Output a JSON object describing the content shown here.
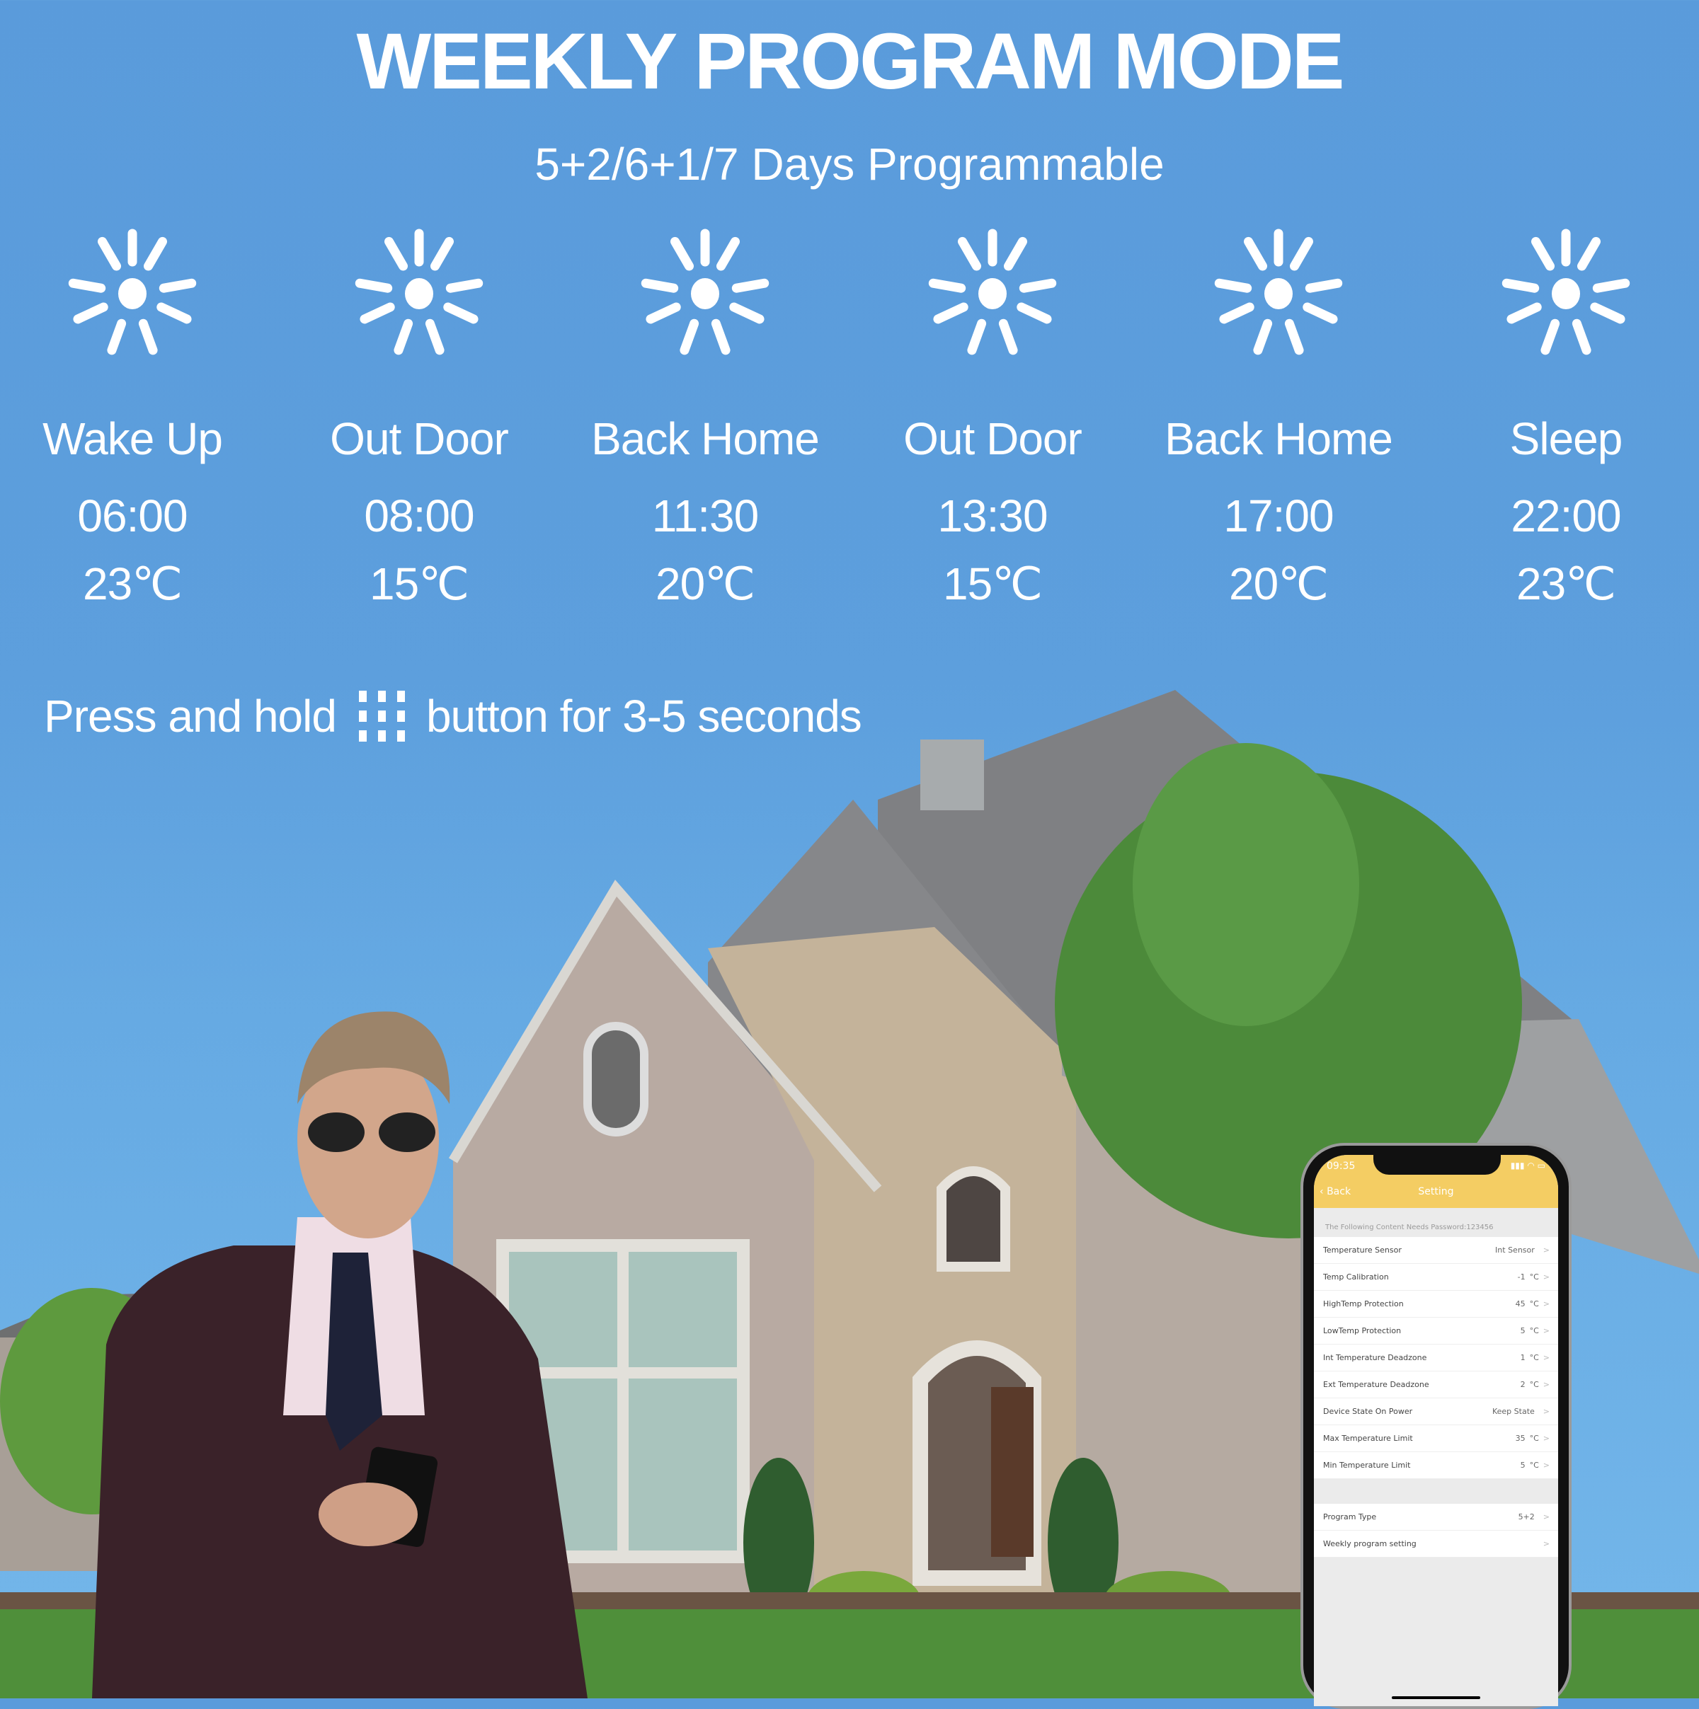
{
  "header": {
    "title": "WEEKLY PROGRAM MODE",
    "subtitle": "5+2/6+1/7 Days Programmable"
  },
  "schedule": [
    {
      "icon": "sun-icon",
      "label": "Wake Up",
      "time": "06:00",
      "temp": "23℃"
    },
    {
      "icon": "sun-icon",
      "label": "Out Door",
      "time": "08:00",
      "temp": "15℃"
    },
    {
      "icon": "sun-icon",
      "label": "Back Home",
      "time": "11:30",
      "temp": "20℃"
    },
    {
      "icon": "sun-icon",
      "label": "Out Door",
      "time": "13:30",
      "temp": "15℃"
    },
    {
      "icon": "sun-icon",
      "label": "Back Home",
      "time": "17:00",
      "temp": "20℃"
    },
    {
      "icon": "sun-icon",
      "label": "Sleep",
      "time": "22:00",
      "temp": "23℃"
    }
  ],
  "hint": {
    "before": "Press and hold",
    "icon": "grid-button-icon",
    "after": "button for 3-5 seconds"
  },
  "phone": {
    "status_time": "09:35",
    "status_icons": "signal wifi battery",
    "back_label": "Back",
    "screen_title": "Setting",
    "section_note": "The Following Content Needs Password:123456",
    "settings": [
      {
        "label": "Temperature Sensor",
        "value": "Int Sensor",
        "unit": ""
      },
      {
        "label": "Temp Calibration",
        "value": "-1",
        "unit": "°C"
      },
      {
        "label": "HighTemp Protection",
        "value": "45",
        "unit": "°C"
      },
      {
        "label": "LowTemp Protection",
        "value": "5",
        "unit": "°C"
      },
      {
        "label": "Int Temperature Deadzone",
        "value": "1",
        "unit": "°C"
      },
      {
        "label": "Ext Temperature Deadzone",
        "value": "2",
        "unit": "°C"
      },
      {
        "label": "Device State On Power",
        "value": "Keep State",
        "unit": ""
      },
      {
        "label": "Max Temperature Limit",
        "value": "35",
        "unit": "°C"
      },
      {
        "label": "Min Temperature Limit",
        "value": "5",
        "unit": "°C"
      }
    ],
    "program": [
      {
        "label": "Program Type",
        "value": "5+2",
        "unit": ""
      },
      {
        "label": "Weekly program setting",
        "value": "",
        "unit": ""
      }
    ],
    "chevron": ">"
  },
  "colors": {
    "sky": "#5a9bdb",
    "app_header": "#f4cd63",
    "text": "#ffffff"
  }
}
